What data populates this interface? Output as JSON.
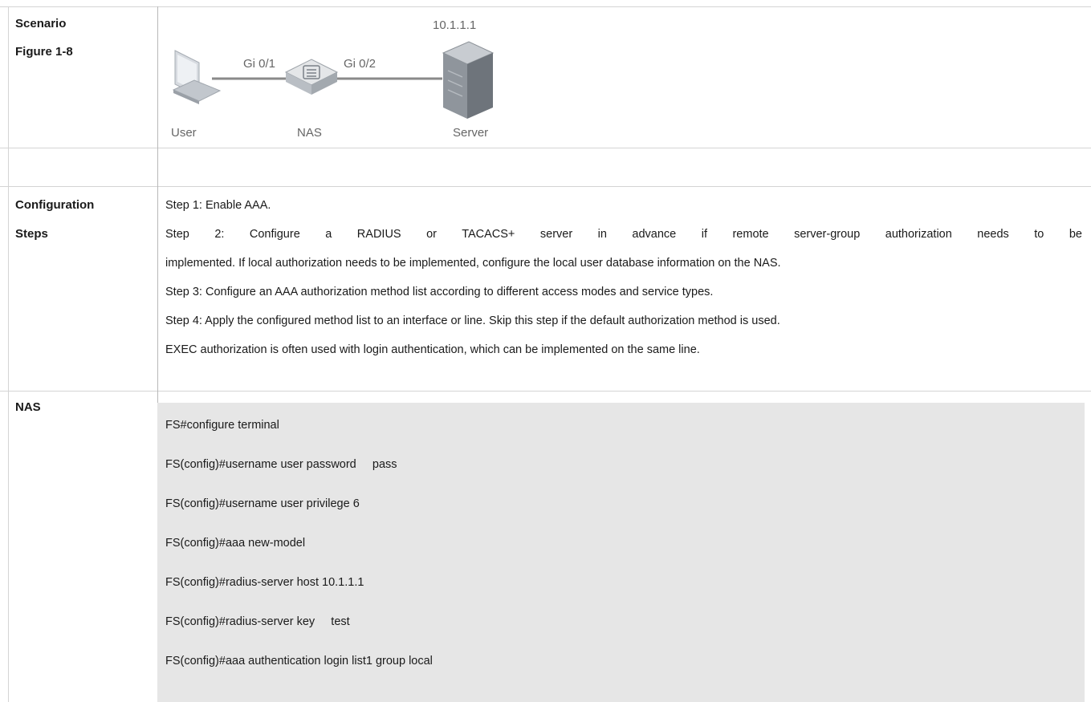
{
  "rows": {
    "scenario": {
      "label1": "Scenario",
      "label2": "Figure 1-8"
    },
    "configuration": {
      "label1": "Configuration",
      "label2": "Steps",
      "steps": [
        "Step 1: Enable AAA.",
        "Step 2: Configure a RADIUS or TACACS+ server in advance if remote server-group authorization needs to be",
        "implemented. If local authorization needs to be implemented, configure the local user database information on the NAS.",
        "Step 3: Configure an AAA authorization method list according to different access modes and service types.",
        "Step 4: Apply the configured method list to an interface or line. Skip this step if the default authorization method is used.",
        "EXEC authorization is often used with login authentication, which can be implemented on the same line."
      ]
    },
    "nas": {
      "label": "NAS",
      "commands": [
        "FS#configure terminal",
        "FS(config)#username user password     pass",
        "FS(config)#username user privilege 6",
        "FS(config)#aaa new-model",
        "FS(config)#radius-server host 10.1.1.1",
        "FS(config)#radius-server key     test",
        "FS(config)#aaa authentication login list1 group local"
      ]
    }
  },
  "figure": {
    "server_ip": "10.1.1.1",
    "port_left": "Gi 0/1",
    "port_right": "Gi 0/2",
    "user_label": "User",
    "nas_label": "NAS",
    "server_label": "Server",
    "icons": [
      "laptop-icon",
      "switch-icon",
      "server-icon"
    ]
  }
}
